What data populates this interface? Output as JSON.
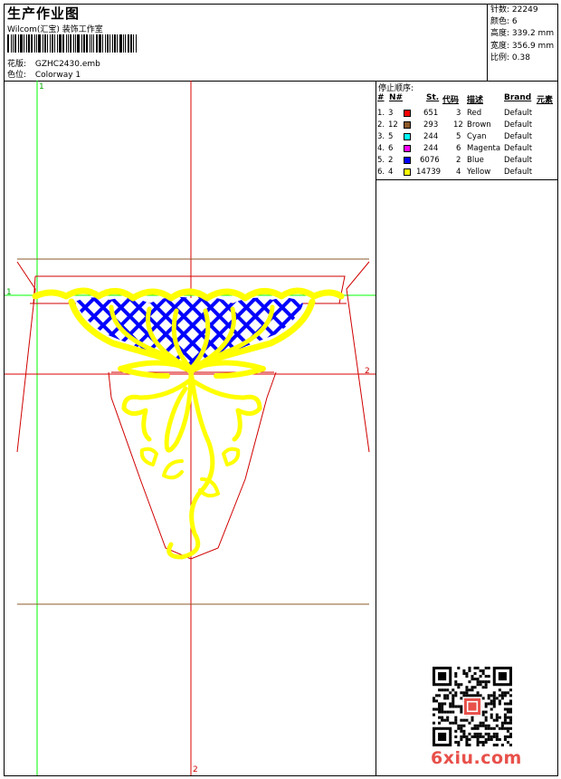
{
  "header": {
    "title": "生产作业图",
    "software": "Wilcom(汇宝) 装饰工作室",
    "design_label": "花版:",
    "design_value": "GZHC2430.emb",
    "colorway_label": "色位:",
    "colorway_value": "Colorway 1"
  },
  "stats": [
    {
      "label": "针数:",
      "value": "22249"
    },
    {
      "label": "颜色:",
      "value": "6"
    },
    {
      "label": "高度:",
      "value": "339.2 mm"
    },
    {
      "label": "宽度:",
      "value": "356.9 mm"
    },
    {
      "label": "比例:",
      "value": "0.38"
    }
  ],
  "stop_sequence": {
    "heading": "停止顺序:",
    "columns": {
      "num": "#",
      "no": "N#",
      "st": "St.",
      "code": "代码",
      "desc": "描述",
      "brand": "Brand",
      "element": "元素"
    },
    "rows": [
      {
        "num": "1.",
        "no": "3",
        "color": "#ff0000",
        "st": "651",
        "code": "3",
        "desc": "Red",
        "brand": "Default"
      },
      {
        "num": "2.",
        "no": "12",
        "color": "#8b5a2b",
        "st": "293",
        "code": "12",
        "desc": "Brown",
        "brand": "Default"
      },
      {
        "num": "3.",
        "no": "5",
        "color": "#00ffff",
        "st": "244",
        "code": "5",
        "desc": "Cyan",
        "brand": "Default"
      },
      {
        "num": "4.",
        "no": "6",
        "color": "#ff00ff",
        "st": "244",
        "code": "6",
        "desc": "Magenta",
        "brand": "Default"
      },
      {
        "num": "5.",
        "no": "2",
        "color": "#0000ff",
        "st": "6076",
        "code": "2",
        "desc": "Blue",
        "brand": "Default"
      },
      {
        "num": "6.",
        "no": "4",
        "color": "#ffff00",
        "st": "14739",
        "code": "4",
        "desc": "Yellow",
        "brand": "Default"
      }
    ]
  },
  "guides": {
    "v1": "1",
    "v2": "2",
    "h1": "1",
    "h2": "2"
  },
  "watermark": "6xiu.com",
  "colors": {
    "guide_green": "#00ff00",
    "guide_red": "#dd0000",
    "outline": "#d00000",
    "brown": "#8b5a2b",
    "yellow": "#ffff00",
    "blue": "#0000ff"
  }
}
